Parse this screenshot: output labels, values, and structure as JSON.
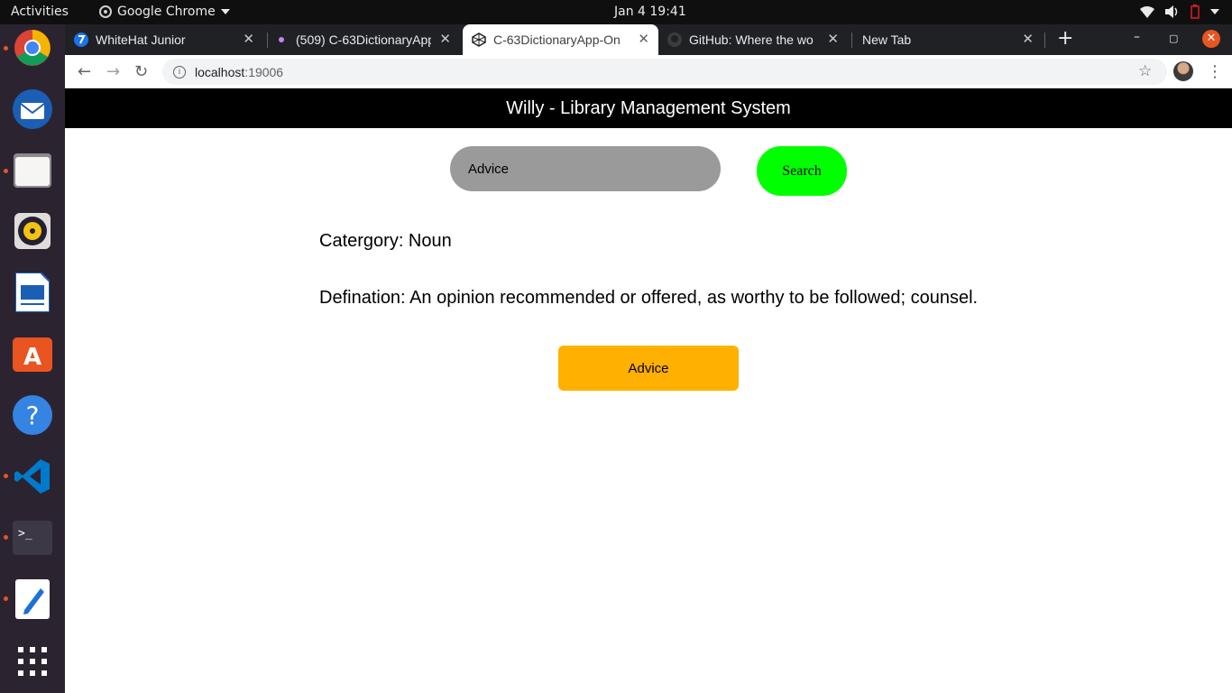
{
  "system_bar": {
    "activities": "Activities",
    "app_name": "Google Chrome",
    "clock": "Jan 4  19:41"
  },
  "dock": {
    "apps": [
      "chrome-icon",
      "thunderbird-icon",
      "files-icon",
      "rhythmbox-icon",
      "writer-icon",
      "software-icon",
      "help-icon",
      "vscode-icon",
      "terminal-icon",
      "text-editor-icon",
      "show-apps-icon"
    ]
  },
  "browser": {
    "tabs": [
      {
        "label": "WhiteHat Junior",
        "active": false
      },
      {
        "label": "(509) C-63DictionaryApp",
        "active": false
      },
      {
        "label": "C-63DictionaryApp-On",
        "active": true
      },
      {
        "label": "GitHub: Where the wo",
        "active": false
      },
      {
        "label": "New Tab",
        "active": false
      }
    ],
    "url_host": "localhost",
    "url_port": ":19006"
  },
  "app": {
    "header_title": "Willy - Library Management System",
    "search_value": "Advice",
    "search_button": "Search",
    "category_text": "Catergory: Noun",
    "definition_text": "Defination: An opinion recommended or offered, as worthy to be followed; counsel.",
    "word_button": "Advice"
  },
  "colors": {
    "header_bg": "#000000",
    "search_button": "#00ff00",
    "word_button": "#ffb000",
    "input_bg": "#9a9a9a"
  }
}
